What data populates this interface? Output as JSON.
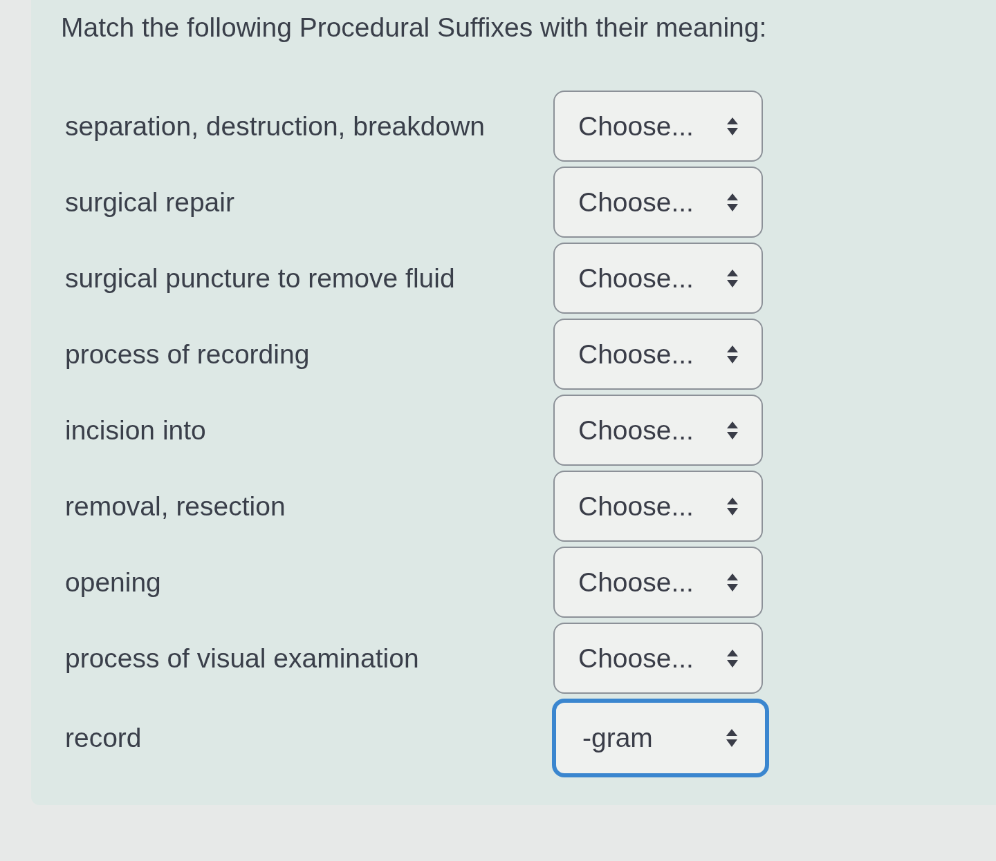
{
  "question": {
    "title": "Match the following Procedural Suffixes with their meaning:"
  },
  "rows": [
    {
      "meaning": "separation, destruction, breakdown",
      "select": {
        "value": "Choose...",
        "focused": false
      }
    },
    {
      "meaning": "surgical repair",
      "select": {
        "value": "Choose...",
        "focused": false
      }
    },
    {
      "meaning": "surgical puncture to remove fluid",
      "select": {
        "value": "Choose...",
        "focused": false
      }
    },
    {
      "meaning": "process of recording",
      "select": {
        "value": "Choose...",
        "focused": false
      }
    },
    {
      "meaning": "incision into",
      "select": {
        "value": "Choose...",
        "focused": false
      }
    },
    {
      "meaning": "removal, resection",
      "select": {
        "value": "Choose...",
        "focused": false
      }
    },
    {
      "meaning": "opening",
      "select": {
        "value": "Choose...",
        "focused": false
      }
    },
    {
      "meaning": "process of visual examination",
      "select": {
        "value": "Choose...",
        "focused": false
      }
    },
    {
      "meaning": "record",
      "select": {
        "value": "-gram",
        "focused": true
      }
    }
  ]
}
